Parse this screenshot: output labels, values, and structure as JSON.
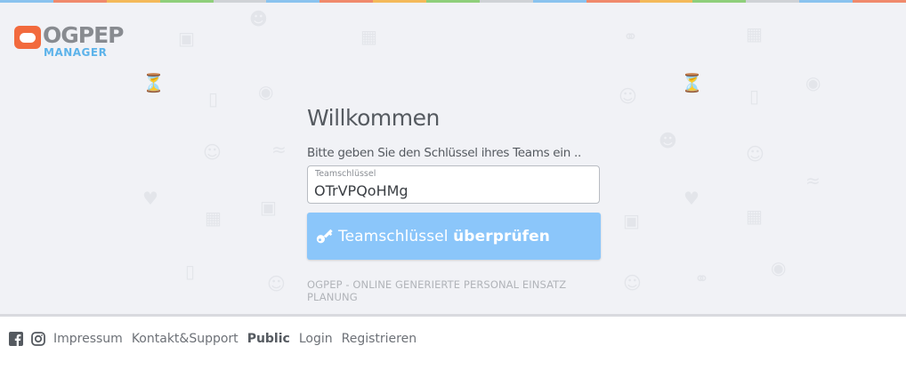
{
  "brand": {
    "name": "OGPEP",
    "subtitle": "MANAGER",
    "logo_color": "#f26a3d",
    "subtitle_color": "#5db3ea"
  },
  "top_stripe_colors": [
    "#8ac3ef",
    "#f08a6c",
    "#f4b95a",
    "#8fcf7b",
    "#cfd2d6",
    "#8ac3ef",
    "#f08a6c",
    "#f4b95a",
    "#8fcf7b",
    "#cfd2d6",
    "#8ac3ef",
    "#f08a6c",
    "#f4b95a",
    "#8fcf7b",
    "#cfd2d6",
    "#8ac3ef",
    "#f08a6c"
  ],
  "login": {
    "heading": "Willkommen",
    "prompt": "Bitte geben Sie den Schlüssel ihres Teams ein ..",
    "field_label": "Teamschlüssel",
    "field_value": "OTrVPQoHMg",
    "button_icon": "key-icon",
    "button_text_normal": "Teamschlüssel ",
    "button_text_bold": "überprüfen",
    "button_color": "#8bc6fa",
    "tagline": "OGPEP - ONLINE GENERIERTE PERSONAL EINSATZ PLANUNG"
  },
  "footer": {
    "icons": [
      "facebook-icon",
      "instagram-icon"
    ],
    "links": [
      {
        "label": "Impressum",
        "active": false
      },
      {
        "label": "Kontakt&Support",
        "active": false
      },
      {
        "label": "Public",
        "active": true
      },
      {
        "label": "Login",
        "active": false
      },
      {
        "label": "Registrieren",
        "active": false
      }
    ]
  },
  "background_icons": [
    "person-icon",
    "mobile-icon",
    "heart-icon",
    "hourglass-icon",
    "wifi-icon",
    "laptop-icon",
    "money-icon",
    "headset-icon",
    "calendar-icon",
    "handshake-icon"
  ]
}
